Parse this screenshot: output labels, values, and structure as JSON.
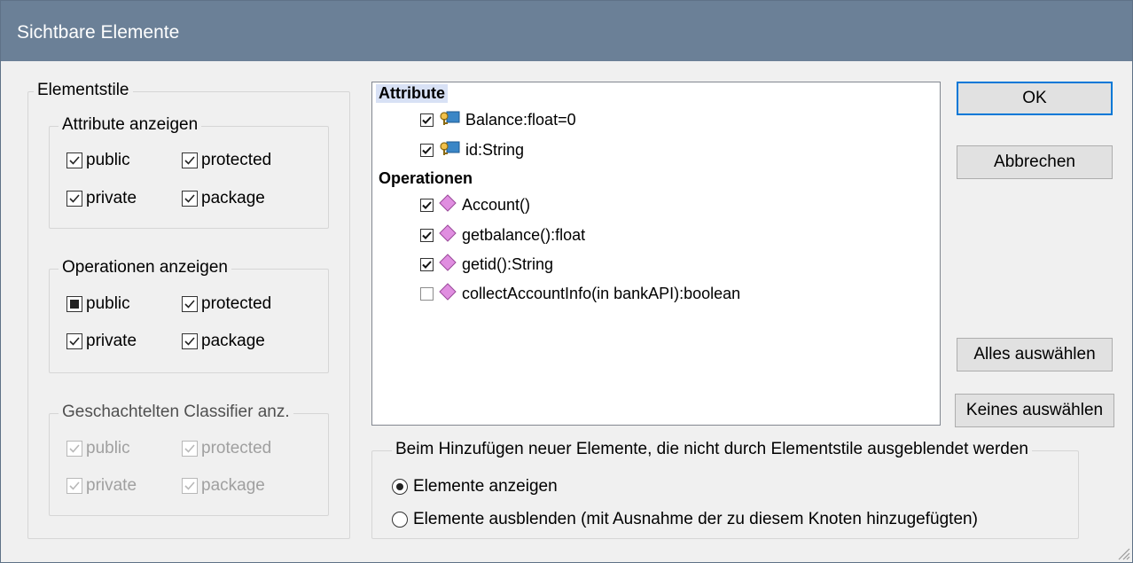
{
  "window": {
    "title": "Sichtbare Elemente"
  },
  "element_styles": {
    "label": "Elementstile",
    "attributes": {
      "label": "Attribute anzeigen",
      "items": [
        {
          "label": "public",
          "state": "checked"
        },
        {
          "label": "protected",
          "state": "checked"
        },
        {
          "label": "private",
          "state": "checked"
        },
        {
          "label": "package",
          "state": "checked"
        }
      ]
    },
    "operations": {
      "label": "Operationen anzeigen",
      "items": [
        {
          "label": "public",
          "state": "indeterminate"
        },
        {
          "label": "protected",
          "state": "checked"
        },
        {
          "label": "private",
          "state": "checked"
        },
        {
          "label": "package",
          "state": "checked"
        }
      ]
    },
    "nested": {
      "label": "Geschachtelten Classifier anz.",
      "disabled": true,
      "items": [
        {
          "label": "public",
          "state": "checked"
        },
        {
          "label": "protected",
          "state": "checked"
        },
        {
          "label": "private",
          "state": "checked"
        },
        {
          "label": "package",
          "state": "checked"
        }
      ]
    }
  },
  "tree": {
    "attributes_heading": "Attribute",
    "attributes": [
      {
        "label": "Balance:float=0",
        "checked": true,
        "icon": "attribute-key-icon"
      },
      {
        "label": "id:String",
        "checked": true,
        "icon": "attribute-key-icon"
      }
    ],
    "operations_heading": "Operationen",
    "operations": [
      {
        "label": "Account()",
        "checked": true,
        "icon": "operation-diamond-icon"
      },
      {
        "label": "getbalance():float",
        "checked": true,
        "icon": "operation-diamond-icon"
      },
      {
        "label": "getid():String",
        "checked": true,
        "icon": "operation-diamond-icon"
      },
      {
        "label": "collectAccountInfo(in bankAPI):boolean",
        "checked": false,
        "icon": "operation-diamond-icon"
      }
    ]
  },
  "buttons": {
    "ok": "OK",
    "cancel": "Abbrechen",
    "select_all": "Alles auswählen",
    "select_none": "Keines auswählen"
  },
  "new_elements": {
    "label": "Beim Hinzufügen neuer Elemente, die nicht durch Elementstile ausgeblendet werden",
    "options": [
      {
        "label": "Elemente anzeigen",
        "selected": true
      },
      {
        "label": "Elemente ausblenden (mit Ausnahme der zu diesem Knoten hinzugefügten)",
        "selected": false
      }
    ]
  },
  "colors": {
    "titlebar": "#6b8097",
    "dialog_bg": "#f0f0f0",
    "selection": "#d8e1f5",
    "default_button_border": "#0078d7",
    "operation_icon": "#d77fd6",
    "attribute_icon": "#3a86c6"
  }
}
